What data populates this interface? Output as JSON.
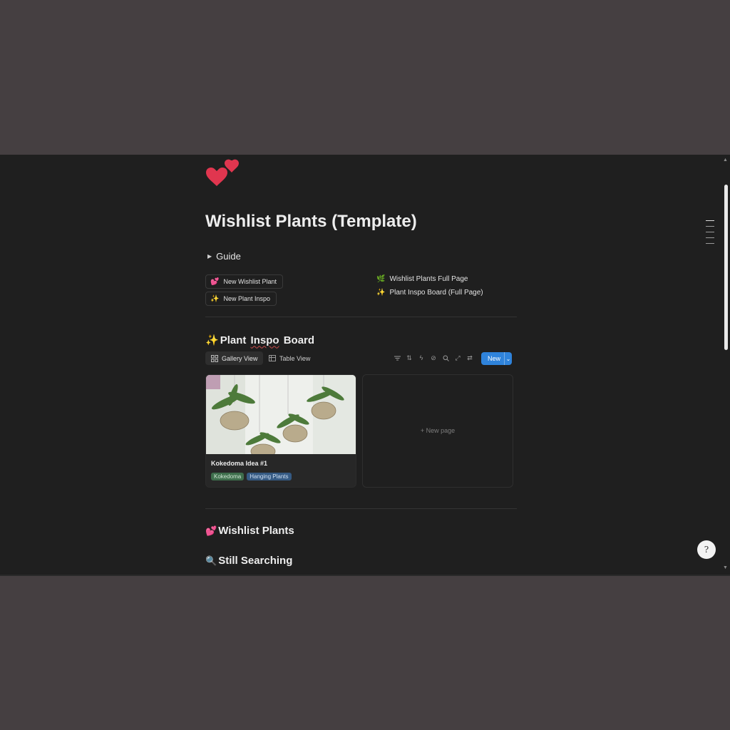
{
  "page": {
    "title": "Wishlist Plants (Template)",
    "icon": "two-hearts-icon"
  },
  "guide": {
    "label": "Guide",
    "icon": "triangle-right-icon"
  },
  "buttons": [
    {
      "label": "New Wishlist Plant",
      "icon": "two-hearts-icon"
    },
    {
      "label": "New Plant Inspo",
      "icon": "sparkles-icon"
    }
  ],
  "links": [
    {
      "label": "Wishlist Plants Full Page",
      "icon": "seedling-sparkle-icon"
    },
    {
      "label": "Plant Inspo Board (Full Page)",
      "icon": "sparkles-icon"
    }
  ],
  "inspo_board": {
    "heading_emoji": "✨",
    "heading_pre": "Plant ",
    "heading_underlined": "Inspo",
    "heading_post": " Board",
    "tabs": [
      {
        "label": "Gallery View",
        "icon": "grid-icon",
        "active": true
      },
      {
        "label": "Table View",
        "icon": "table-icon",
        "active": false
      }
    ],
    "tools": [
      "filter-icon",
      "sort-icon",
      "lightning-icon",
      "eye-off-icon",
      "search-icon",
      "expand-icon",
      "settings-sliders-icon"
    ],
    "new_button": {
      "label": "New",
      "chevron": "⌄"
    },
    "cards": [
      {
        "title": "Kokedoma Idea #1",
        "cover": "hanging-plants-photo",
        "tags": [
          {
            "label": "Kokedoma",
            "bg": "#3e6e4c",
            "fg": "#cfe7d3"
          },
          {
            "label": "Hanging Plants",
            "bg": "#355a83",
            "fg": "#cfe0f4"
          }
        ]
      }
    ],
    "new_page_label": "+ New page"
  },
  "sections": [
    {
      "emoji": "💕",
      "label": "Wishlist Plants"
    },
    {
      "emoji": "🔍",
      "label": "Still Searching"
    }
  ],
  "help": {
    "label": "?"
  },
  "colors": {
    "background": "#1f1f1f",
    "outer": "#453f41",
    "accent": "#2f83db",
    "heart": "#e0364f"
  }
}
